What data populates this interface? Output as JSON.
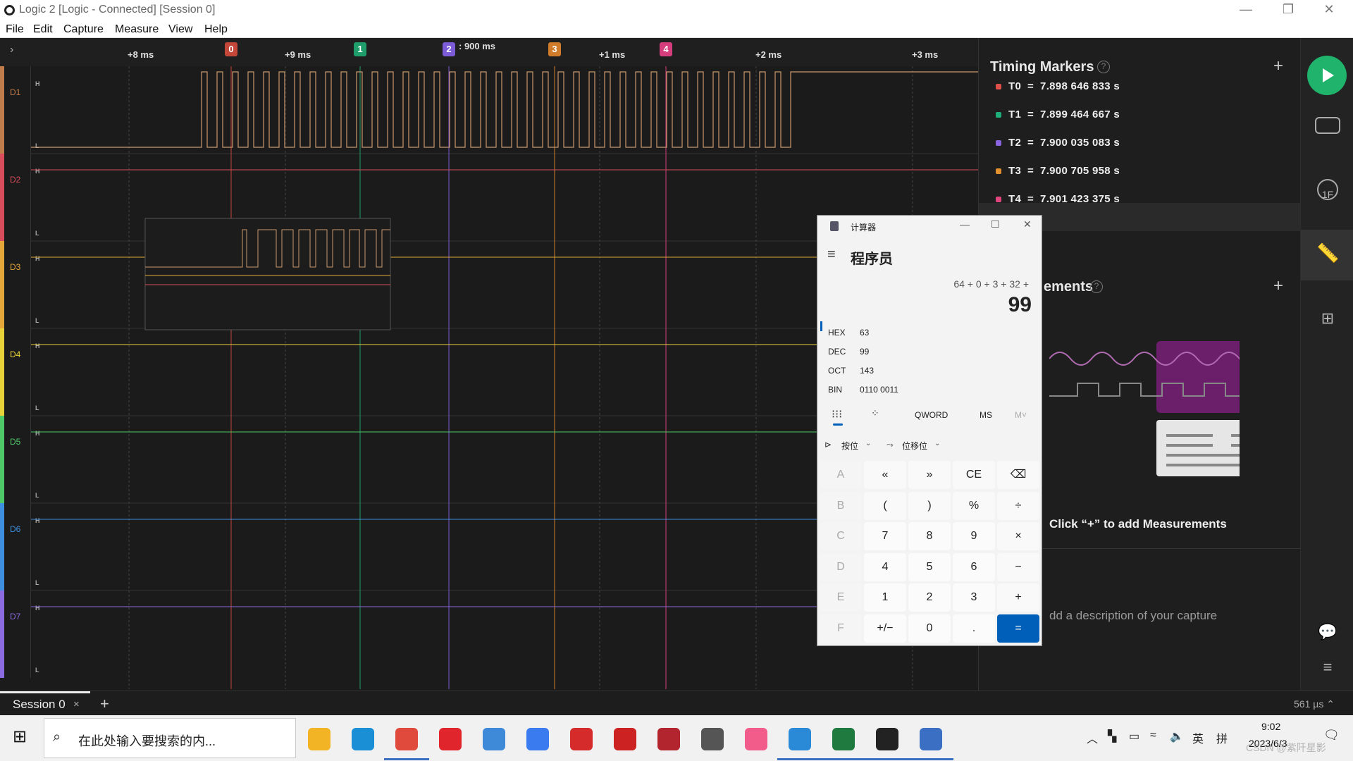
{
  "window": {
    "title": "Logic 2 [Logic - Connected] [Session 0]"
  },
  "menu": [
    "File",
    "Edit",
    "Capture",
    "Measure",
    "View",
    "Help"
  ],
  "ruler": {
    "ticks": [
      "+8 ms",
      "+9 ms",
      "+1 ms",
      "+2 ms",
      "+3 ms"
    ],
    "center_label": ": 900 ms",
    "markers": [
      {
        "label": "0",
        "color": "#c4473a"
      },
      {
        "label": "1",
        "color": "#1f9e6b"
      },
      {
        "label": "2",
        "color": "#7b5bd6"
      },
      {
        "label": "3",
        "color": "#d17c2a"
      },
      {
        "label": "4",
        "color": "#d63d7c"
      }
    ]
  },
  "channels": [
    {
      "name": "D1",
      "color": "#c07c4a"
    },
    {
      "name": "D2",
      "color": "#d94c5c"
    },
    {
      "name": "D3",
      "color": "#e3a73a"
    },
    {
      "name": "D4",
      "color": "#e8d23a"
    },
    {
      "name": "D5",
      "color": "#4fc86a"
    },
    {
      "name": "D6",
      "color": "#3e8fe0"
    },
    {
      "name": "D7",
      "color": "#8c6ae0"
    }
  ],
  "level_high": "H",
  "level_low": "L",
  "sidebar": {
    "timing_title": "Timing Markers",
    "timing_markers": [
      {
        "label": "T0",
        "eq": "=",
        "value": "7.898 646 833 s",
        "color": "#e0504a"
      },
      {
        "label": "T1",
        "eq": "=",
        "value": "7.899 464 667 s",
        "color": "#1fae7a"
      },
      {
        "label": "T2",
        "eq": "=",
        "value": "7.900 035 083 s",
        "color": "#8a63df"
      },
      {
        "label": "T3",
        "eq": "=",
        "value": "7.900 705 958 s",
        "color": "#e3902e"
      },
      {
        "label": "T4",
        "eq": "=",
        "value": "7.901 423 375 s",
        "color": "#e0457e"
      }
    ],
    "measurements_title": "ements",
    "add_hint": "Click “+” to add Measurements",
    "description_hint": "dd a description of your capture"
  },
  "calculator": {
    "window_title": "计算器",
    "mode": "程序员",
    "expression": "64 + 0 + 3 + 32 +",
    "result": "99",
    "radix": [
      {
        "label": "HEX",
        "value": "63"
      },
      {
        "label": "DEC",
        "value": "99"
      },
      {
        "label": "OCT",
        "value": "143"
      },
      {
        "label": "BIN",
        "value": "0110 0011"
      }
    ],
    "word_size": "QWORD",
    "ms": "MS",
    "mv": "M˅",
    "bitwise": "按位",
    "bitshift": "位移位",
    "keys": [
      [
        "A",
        "«",
        "»",
        "CE",
        "⌫"
      ],
      [
        "B",
        "(",
        ")",
        "%",
        "÷"
      ],
      [
        "C",
        "7",
        "8",
        "9",
        "×"
      ],
      [
        "D",
        "4",
        "5",
        "6",
        "−"
      ],
      [
        "E",
        "1",
        "2",
        "3",
        "+"
      ],
      [
        "F",
        "+/−",
        "0",
        ".",
        "="
      ]
    ]
  },
  "session": {
    "tab": "Session 0",
    "close": "×",
    "add": "+",
    "sample": "561 µs ⌃"
  },
  "taskbar": {
    "search_placeholder": "在此处输入要搜索的内...",
    "apps": [
      {
        "icon": "explorer-icon",
        "color": "#f2b425"
      },
      {
        "icon": "edge-icon",
        "color": "#1a8fd6"
      },
      {
        "icon": "chrome-icon",
        "color": "#e04a3c"
      },
      {
        "icon": "youdao-icon",
        "color": "#e1252d"
      },
      {
        "icon": "cloud-icon",
        "color": "#3e8ad8"
      },
      {
        "icon": "feishu-icon",
        "color": "#3a7bf0"
      },
      {
        "icon": "wps-icon",
        "color": "#d62b2b"
      },
      {
        "icon": "atk-xcom-icon",
        "color": "#c22"
      },
      {
        "icon": "serial-icon",
        "color": "#b2252e"
      },
      {
        "icon": "twitch-icon",
        "color": "#555"
      },
      {
        "icon": "bilibili-icon",
        "color": "#f25c8a"
      },
      {
        "icon": "vscode-icon",
        "color": "#2a8ad8"
      },
      {
        "icon": "excel-icon",
        "color": "#1f7a3f"
      },
      {
        "icon": "logic-icon",
        "color": "#222"
      },
      {
        "icon": "calculator-icon",
        "color": "#3a6fc4"
      }
    ],
    "tray_lang": "英",
    "tray_ime": "拼",
    "time": "9:02",
    "date": "2023/6/3",
    "watermark": "CSDN @紫阡星影"
  }
}
